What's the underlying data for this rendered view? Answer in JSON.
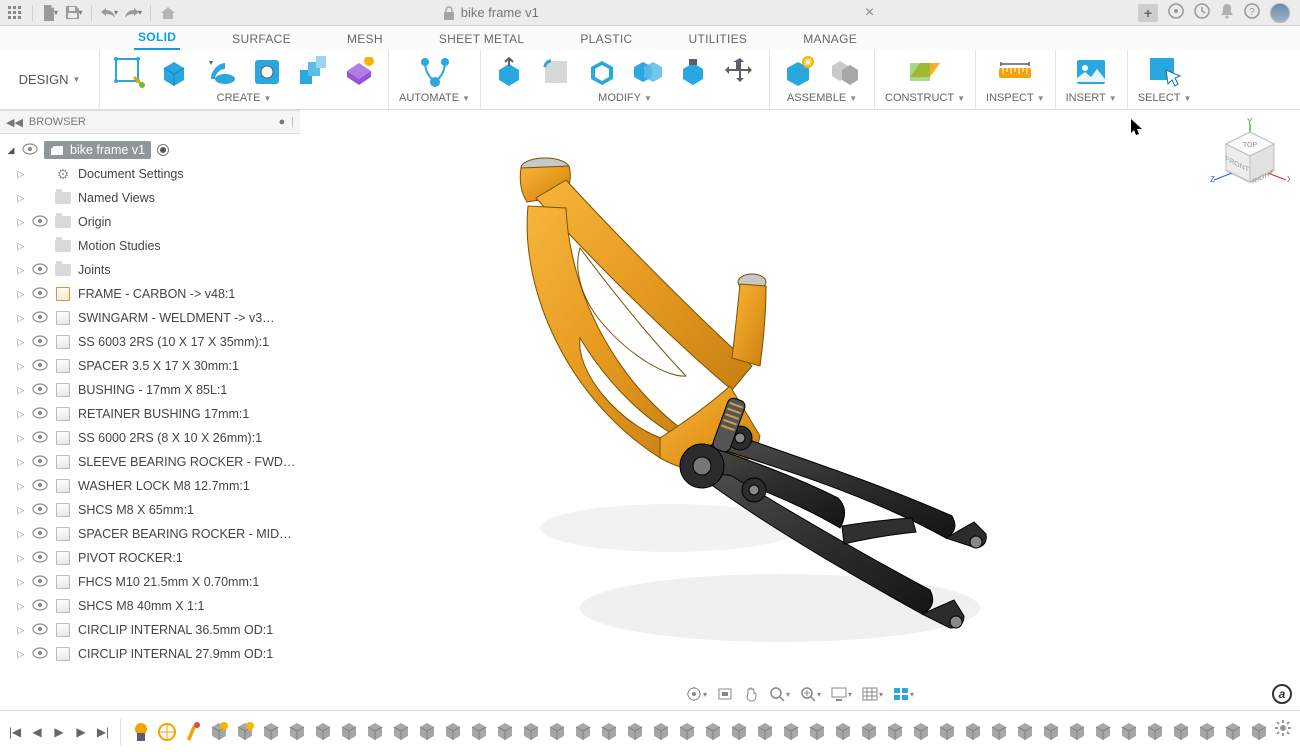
{
  "app": {
    "title": "bike frame v1",
    "design_button": "DESIGN"
  },
  "ribbon": {
    "tabs": [
      "SOLID",
      "SURFACE",
      "MESH",
      "SHEET METAL",
      "PLASTIC",
      "UTILITIES",
      "MANAGE"
    ],
    "active": 0,
    "groups": {
      "create": "CREATE",
      "automate": "AUTOMATE",
      "modify": "MODIFY",
      "assemble": "ASSEMBLE",
      "construct": "CONSTRUCT",
      "inspect": "INSPECT",
      "insert": "INSERT",
      "select": "SELECT"
    }
  },
  "browser": {
    "header": "BROWSER",
    "root": "bike frame v1",
    "items": [
      {
        "icon": "gear",
        "label": "Document Settings"
      },
      {
        "icon": "folder",
        "label": "Named Views"
      },
      {
        "icon": "folder",
        "label": "Origin",
        "eye": true
      },
      {
        "icon": "folder",
        "label": "Motion Studies"
      },
      {
        "icon": "folder",
        "label": "Joints",
        "eye": true
      },
      {
        "icon": "comp-link",
        "label": "FRAME - CARBON -> v48:1",
        "eye": true
      },
      {
        "icon": "comp",
        "label": "SWINGARM - WELDMENT -> v3…",
        "eye": true
      },
      {
        "icon": "comp",
        "label": "SS 6003 2RS (10 X 17 X 35mm):1",
        "eye": true
      },
      {
        "icon": "comp",
        "label": "SPACER 3.5 X 17 X 30mm:1",
        "eye": true
      },
      {
        "icon": "comp",
        "label": "BUSHING - 17mm X 85L:1",
        "eye": true
      },
      {
        "icon": "comp",
        "label": "RETAINER BUSHING 17mm:1",
        "eye": true
      },
      {
        "icon": "comp",
        "label": "SS 6000 2RS (8 X 10 X 26mm):1",
        "eye": true
      },
      {
        "icon": "comp",
        "label": "SLEEVE BEARING ROCKER - FWD…",
        "eye": true
      },
      {
        "icon": "comp",
        "label": "WASHER LOCK M8 12.7mm:1",
        "eye": true
      },
      {
        "icon": "comp",
        "label": "SHCS M8 X 65mm:1",
        "eye": true
      },
      {
        "icon": "comp",
        "label": "SPACER BEARING ROCKER - MID…",
        "eye": true
      },
      {
        "icon": "comp",
        "label": "PIVOT ROCKER:1",
        "eye": true
      },
      {
        "icon": "comp",
        "label": "FHCS M10 21.5mm X 0.70mm:1",
        "eye": true
      },
      {
        "icon": "comp",
        "label": "SHCS M8 40mm X 1:1",
        "eye": true
      },
      {
        "icon": "comp",
        "label": "CIRCLIP INTERNAL 36.5mm OD:1",
        "eye": true
      },
      {
        "icon": "comp",
        "label": "CIRCLIP INTERNAL 27.9mm OD:1",
        "eye": true
      }
    ]
  },
  "viewcube": {
    "faces": [
      "TOP",
      "FRONT",
      "RIGHT"
    ],
    "axes": [
      "X",
      "Y",
      "Z"
    ]
  },
  "timeline": {
    "count": 44
  }
}
